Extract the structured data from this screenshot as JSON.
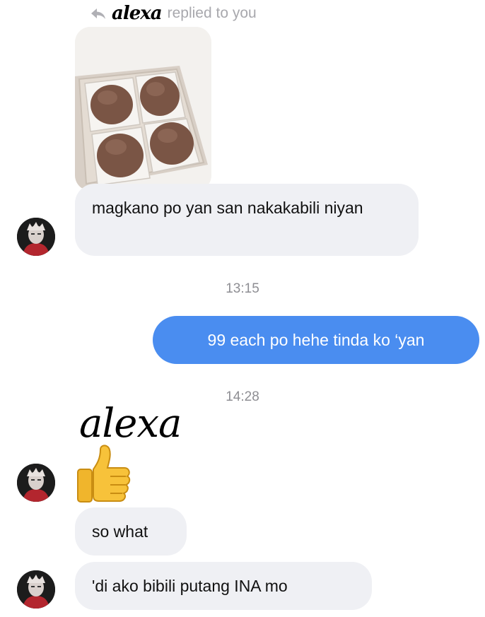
{
  "reply_header": {
    "name": "alexa",
    "text": "replied to you"
  },
  "messages": {
    "m1": "magkano po yan san nakakabili niyan",
    "t1": "13:15",
    "m2": "99 each po hehe tinda ko ‘yan",
    "t2": "14:28",
    "sender_name": "alexa",
    "m3_emoji": "👍",
    "m4": "so what",
    "m5": "'di ako bibili putang INA mo"
  },
  "icons": {
    "reply": "reply-arrow-icon",
    "reaction": "thumbs-up-emoji"
  },
  "colors": {
    "incoming_bubble": "#eff0f4",
    "outgoing_bubble": "#4a8df0",
    "muted_text": "#a8a8ad"
  }
}
